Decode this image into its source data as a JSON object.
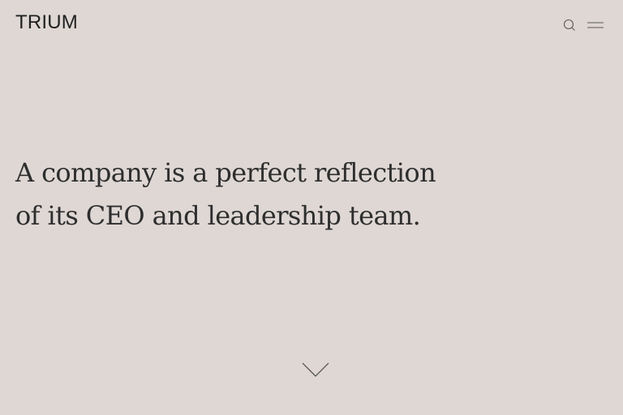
{
  "header": {
    "logo_text": "TRIUM",
    "search_icon": "search-icon",
    "menu_icon": "menu-icon"
  },
  "hero": {
    "line1": "A company is a perfect reflection",
    "line2": "of its CEO and leadership team."
  },
  "scroll": {
    "icon": "chevron-down-icon"
  },
  "colors": {
    "background": "#ded7d4",
    "text": "#2b2b2b",
    "icon": "#555555"
  }
}
